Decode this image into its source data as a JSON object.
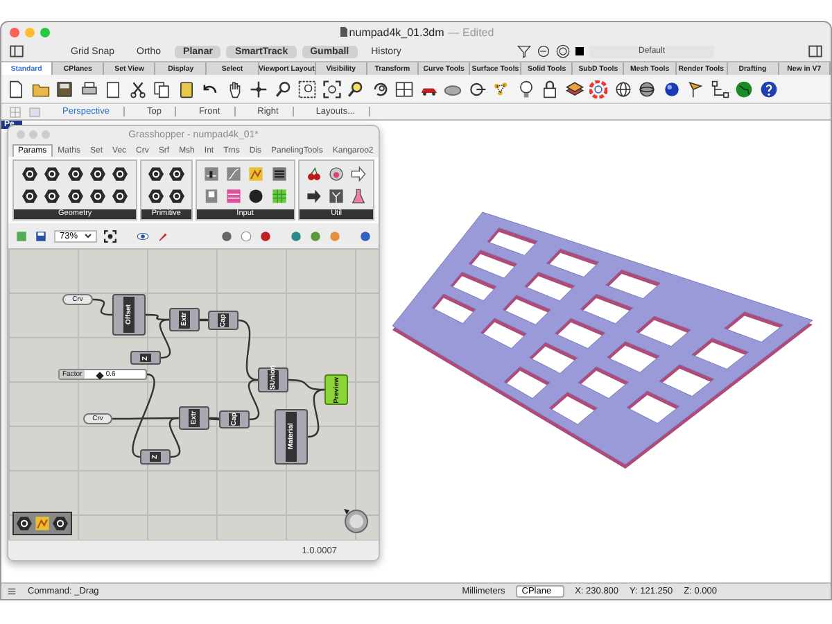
{
  "window": {
    "title": "numpad4k_01.3dm",
    "status": "— Edited"
  },
  "toolbar": {
    "toggles": [
      {
        "label": "Grid Snap",
        "on": false
      },
      {
        "label": "Ortho",
        "on": false
      },
      {
        "label": "Planar",
        "on": true
      },
      {
        "label": "SmartTrack",
        "on": true
      },
      {
        "label": "Gumball",
        "on": true
      },
      {
        "label": "History",
        "on": false
      }
    ],
    "layer": "Default"
  },
  "toolbar_tabs": [
    {
      "label": "Standard",
      "selected": true
    },
    {
      "label": "CPlanes",
      "selected": false
    },
    {
      "label": "Set View",
      "selected": false
    },
    {
      "label": "Display",
      "selected": false
    },
    {
      "label": "Select",
      "selected": false
    },
    {
      "label": "Viewport Layout",
      "selected": false
    },
    {
      "label": "Visibility",
      "selected": false
    },
    {
      "label": "Transform",
      "selected": false
    },
    {
      "label": "Curve Tools",
      "selected": false
    },
    {
      "label": "Surface Tools",
      "selected": false
    },
    {
      "label": "Solid Tools",
      "selected": false
    },
    {
      "label": "SubD Tools",
      "selected": false
    },
    {
      "label": "Mesh Tools",
      "selected": false
    },
    {
      "label": "Render Tools",
      "selected": false
    },
    {
      "label": "Drafting",
      "selected": false
    },
    {
      "label": "New in V7",
      "selected": false
    }
  ],
  "viewport_tabs": [
    {
      "label": "Perspective",
      "selected": true
    },
    {
      "label": "Top",
      "selected": false
    },
    {
      "label": "Front",
      "selected": false
    },
    {
      "label": "Right",
      "selected": false
    },
    {
      "label": "Layouts...",
      "selected": false
    }
  ],
  "viewport": {
    "label": "Pe"
  },
  "grasshopper": {
    "title": "Grasshopper - numpad4k_01*",
    "tabs": [
      {
        "label": "Params",
        "selected": true
      },
      {
        "label": "Maths",
        "selected": false
      },
      {
        "label": "Set",
        "selected": false
      },
      {
        "label": "Vec",
        "selected": false
      },
      {
        "label": "Crv",
        "selected": false
      },
      {
        "label": "Srf",
        "selected": false
      },
      {
        "label": "Msh",
        "selected": false
      },
      {
        "label": "Int",
        "selected": false
      },
      {
        "label": "Trns",
        "selected": false
      },
      {
        "label": "Dis",
        "selected": false
      },
      {
        "label": "PanelingTools",
        "selected": false
      },
      {
        "label": "Kangaroo2",
        "selected": false
      }
    ],
    "panels": [
      {
        "label": "Geometry"
      },
      {
        "label": "Primitive"
      },
      {
        "label": "Input"
      },
      {
        "label": "Util"
      }
    ],
    "zoom": "73%",
    "nodes": [
      {
        "kind": "param",
        "label": "Crv"
      },
      {
        "kind": "component",
        "label": "Offset"
      },
      {
        "kind": "component",
        "label": "Extr"
      },
      {
        "kind": "component",
        "label": "Cap"
      },
      {
        "kind": "component",
        "label": "Z"
      },
      {
        "kind": "slider",
        "label": "Factor",
        "value": "0.6",
        "level": 0.2
      },
      {
        "kind": "component",
        "label": "SUnion"
      },
      {
        "kind": "preview",
        "label": "Preview"
      },
      {
        "kind": "param",
        "label": "Crv"
      },
      {
        "kind": "component",
        "label": "Extr"
      },
      {
        "kind": "component",
        "label": "Cap"
      },
      {
        "kind": "component",
        "label": "Material"
      },
      {
        "kind": "component",
        "label": "Z"
      }
    ],
    "version": "1.0.0007"
  },
  "status_bar": {
    "command": "Command: _Drag",
    "units": "Millimeters",
    "cplane": "CPlane",
    "x": "X: 230.800",
    "y": "Y: 121.250",
    "z": "Z: 0.000"
  }
}
